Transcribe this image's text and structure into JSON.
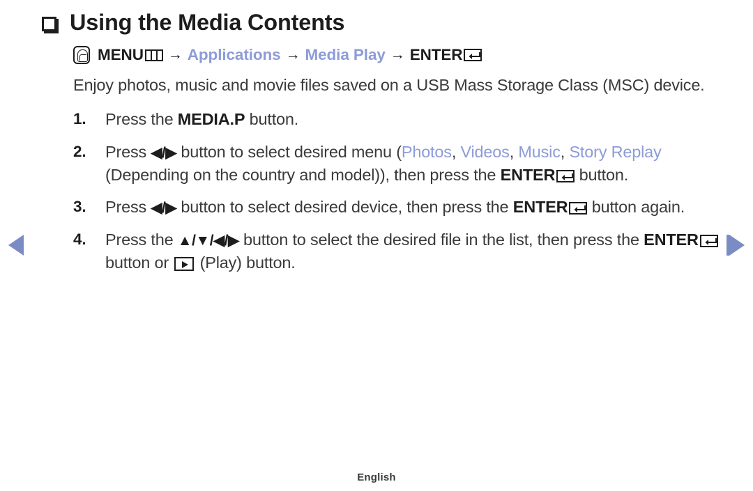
{
  "page": {
    "title": "Using the Media Contents",
    "bullet_icon": "square-bullet-icon",
    "footer_label": "English"
  },
  "colors": {
    "accent_blue": "#8d9cd8",
    "nav_arrow": "#7b8cc4",
    "text": "#3a3a3a",
    "heading": "#1d1d1d",
    "background": "#ffffff"
  },
  "navigation": {
    "prev_label": "previous-page",
    "next_label": "next-page"
  },
  "menu_path": {
    "press_icon": "hand-press-icon",
    "menu_label": "MENU",
    "menu_icon": "menu-grid-icon",
    "arrow": "→",
    "item1": "Applications",
    "item2": "Media Play",
    "enter_label": "ENTER",
    "enter_icon": "enter-return-icon"
  },
  "intro": {
    "text": "Enjoy photos, music and movie files saved on a USB Mass Storage Class (MSC) device."
  },
  "steps": [
    {
      "number": "1.",
      "parts": {
        "p1": "Press the ",
        "bold1": "MEDIA.P",
        "p2": " button."
      }
    },
    {
      "number": "2.",
      "parts": {
        "p1": "Press ",
        "dpad": "◀/▶",
        "p2": " button to select desired menu (",
        "blue1": "Photos",
        "sep1": ", ",
        "blue2": "Videos",
        "sep2": ", ",
        "blue3": "Music",
        "sep3": ", ",
        "blue4": "Story Replay",
        "p3": " (Depending on the country and model)), then press the ",
        "bold1": "ENTER",
        "p4": " button."
      }
    },
    {
      "number": "3.",
      "parts": {
        "p1": "Press ",
        "dpad": "◀/▶",
        "p2": " button to select desired device, then press the ",
        "bold1": "ENTER",
        "p3": " button again."
      }
    },
    {
      "number": "4.",
      "parts": {
        "p1": "Press the ",
        "dpad": "▲/▼/◀/▶",
        "p2": " button to select the desired file in the list, then press the ",
        "bold1": "ENTER",
        "p3": " button or ",
        "play_icon": "play-button-icon",
        "p4": " (Play) button."
      }
    }
  ]
}
